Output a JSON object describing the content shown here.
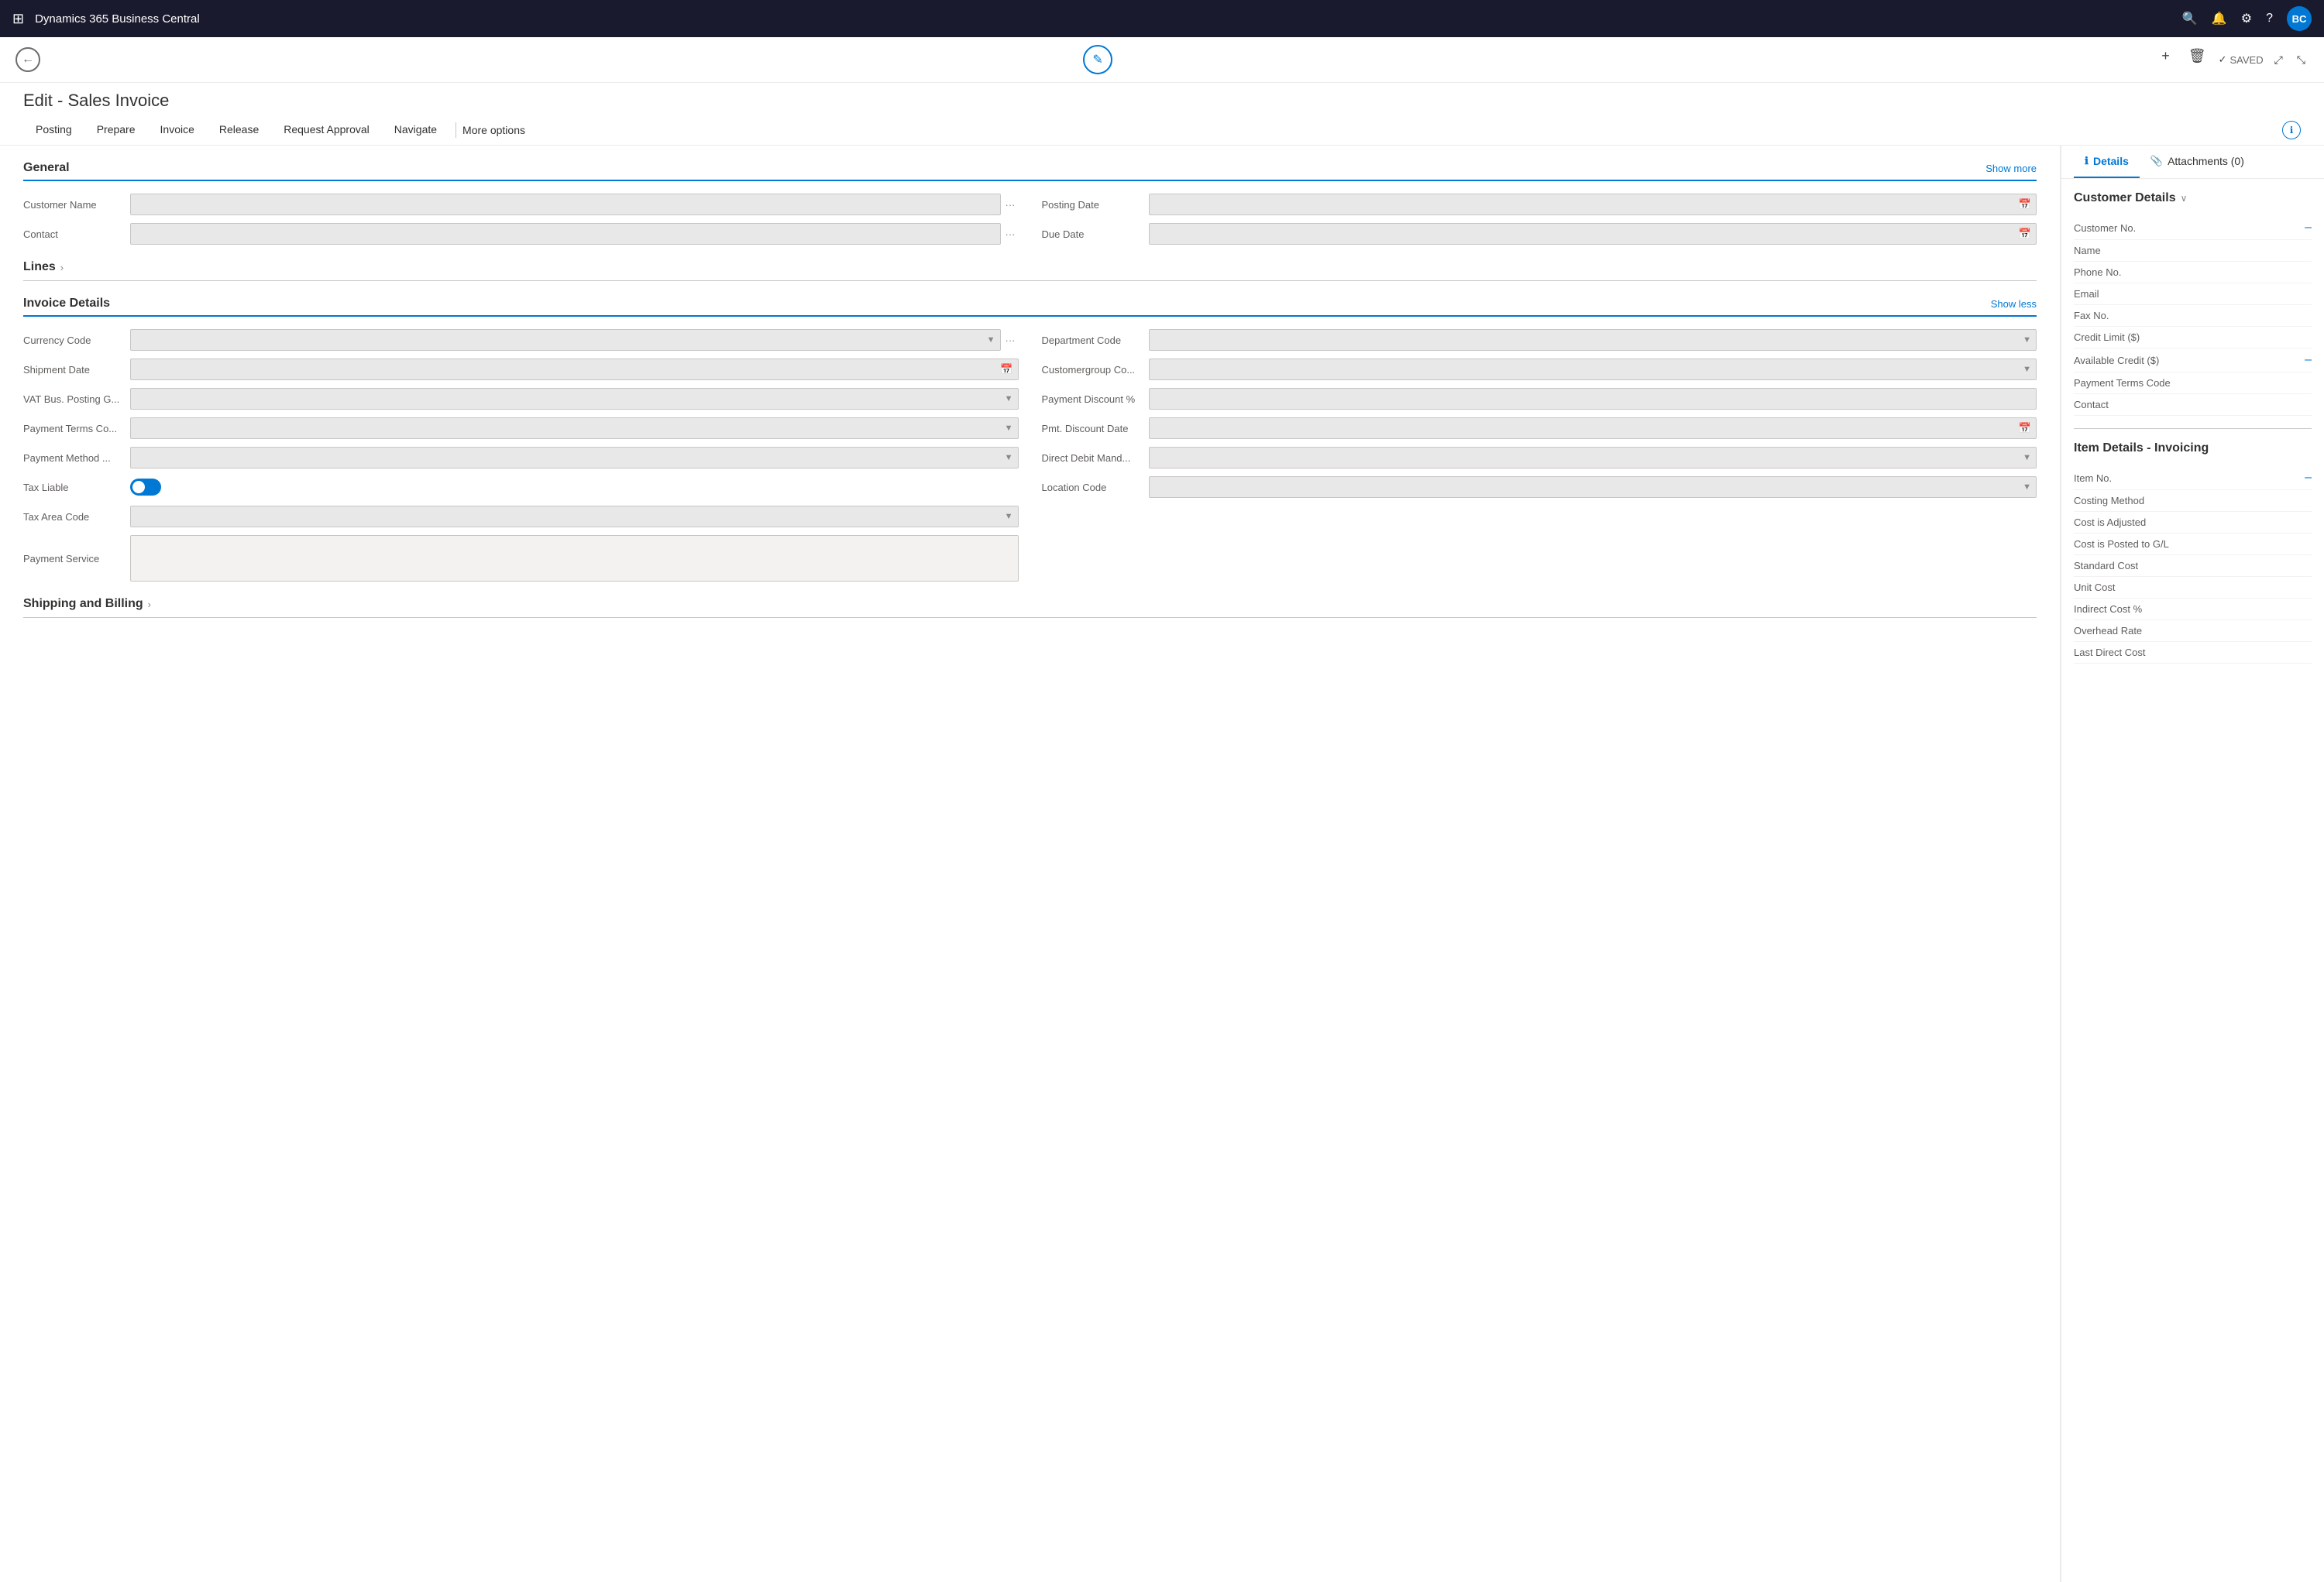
{
  "topbar": {
    "app_title": "Dynamics 365 Business Central",
    "avatar_initials": "BC"
  },
  "toolbar": {
    "back_icon": "←",
    "edit_icon": "✎",
    "add_icon": "+",
    "delete_icon": "🗑",
    "saved_label": "SAVED",
    "expand_icon": "⤢",
    "collapse_icon": "⤡"
  },
  "page": {
    "title": "Edit - Sales Invoice"
  },
  "nav_tabs": {
    "items": [
      "Posting",
      "Prepare",
      "Invoice",
      "Release",
      "Request Approval",
      "Navigate"
    ],
    "more_label": "More options"
  },
  "general": {
    "title": "General",
    "show_more": "Show more",
    "customer_name_label": "Customer Name",
    "contact_label": "Contact",
    "posting_date_label": "Posting Date",
    "due_date_label": "Due Date"
  },
  "lines": {
    "title": "Lines"
  },
  "invoice_details": {
    "title": "Invoice Details",
    "show_less": "Show less",
    "currency_code_label": "Currency Code",
    "shipment_date_label": "Shipment Date",
    "vat_bus_label": "VAT Bus. Posting G...",
    "payment_terms_co_label": "Payment Terms Co...",
    "payment_method_label": "Payment Method ...",
    "tax_liable_label": "Tax Liable",
    "tax_area_code_label": "Tax Area Code",
    "payment_service_label": "Payment Service",
    "department_code_label": "Department Code",
    "customergroup_label": "Customergroup Co...",
    "payment_discount_label": "Payment Discount %",
    "pmt_discount_date_label": "Pmt. Discount Date",
    "direct_debit_label": "Direct Debit Mand...",
    "location_code_label": "Location Code"
  },
  "shipping": {
    "title": "Shipping and Billing"
  },
  "right_panel": {
    "tabs": [
      {
        "label": "Details",
        "icon": "ℹ",
        "active": true
      },
      {
        "label": "Attachments (0)",
        "icon": "📎",
        "active": false
      }
    ]
  },
  "customer_details": {
    "title": "Customer Details",
    "chevron": "∨",
    "rows": [
      {
        "label": "Customer No.",
        "value": "–",
        "has_value": true
      },
      {
        "label": "Name",
        "value": "",
        "has_value": false
      },
      {
        "label": "Phone No.",
        "value": "",
        "has_value": false
      },
      {
        "label": "Email",
        "value": "",
        "has_value": false
      },
      {
        "label": "Fax No.",
        "value": "",
        "has_value": false
      },
      {
        "label": "Credit Limit ($)",
        "value": "",
        "has_value": false
      },
      {
        "label": "Available Credit ($)",
        "value": "–",
        "has_value": true
      },
      {
        "label": "Payment Terms Code",
        "value": "",
        "has_value": false
      },
      {
        "label": "Contact",
        "value": "",
        "has_value": false
      }
    ]
  },
  "item_details": {
    "title": "Item Details - Invoicing",
    "rows": [
      {
        "label": "Item No.",
        "value": "–",
        "has_dash": true
      },
      {
        "label": "Costing Method",
        "value": "",
        "has_dash": false
      },
      {
        "label": "Cost is Adjusted",
        "value": "",
        "has_dash": false
      },
      {
        "label": "Cost is Posted to G/L",
        "value": "",
        "has_dash": false
      },
      {
        "label": "Standard Cost",
        "value": "",
        "has_dash": false
      },
      {
        "label": "Unit Cost",
        "value": "",
        "has_dash": false
      },
      {
        "label": "Indirect Cost %",
        "value": "",
        "has_dash": false
      },
      {
        "label": "Overhead Rate",
        "value": "",
        "has_dash": false
      },
      {
        "label": "Last Direct Cost",
        "value": "",
        "has_dash": false
      }
    ]
  }
}
